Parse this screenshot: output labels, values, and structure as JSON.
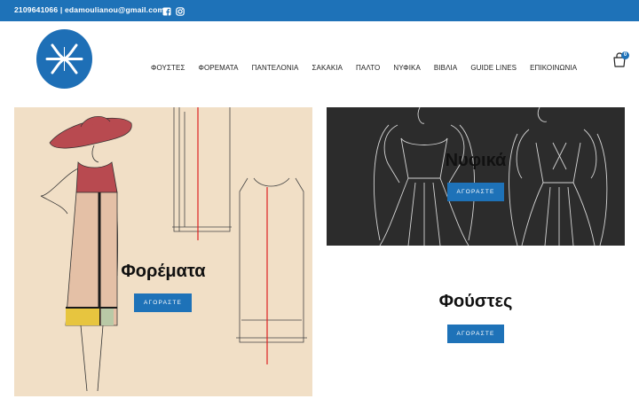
{
  "topbar": {
    "contact": "2109641066 | edamoulianou@gmail.com",
    "icons": [
      "facebook-icon",
      "instagram-icon"
    ]
  },
  "nav": {
    "items": [
      {
        "label": "ΦΟΥΣΤΕΣ"
      },
      {
        "label": "ΦΟΡΕΜΑΤΑ"
      },
      {
        "label": "ΠΑΝΤΕΛΟΝΙΑ"
      },
      {
        "label": "ΣΑΚΑΚΙΑ"
      },
      {
        "label": "ΠΑΛΤΟ"
      },
      {
        "label": "ΝΥΦΙΚΑ"
      },
      {
        "label": "ΒΙΒΛΙΑ"
      },
      {
        "label": "GUIDE LINES"
      },
      {
        "label": "ΕΠΙΚΟΙΝΩΝΙΑ"
      }
    ],
    "cart_count": "0"
  },
  "panels": {
    "dresses": {
      "title": "Φορέματα",
      "button": "ΑΓΟΡΑΣΤΕ"
    },
    "bridal": {
      "title": "Νυφικά",
      "button": "ΑΓΟΡΑΣΤΕ"
    },
    "skirts": {
      "title": "Φούστες",
      "button": "ΑΓΟΡΑΣΤΕ"
    }
  },
  "colors": {
    "accent": "#1e72b8",
    "paper": "#f1dfc6",
    "dark_panel": "#2c2c2c"
  }
}
